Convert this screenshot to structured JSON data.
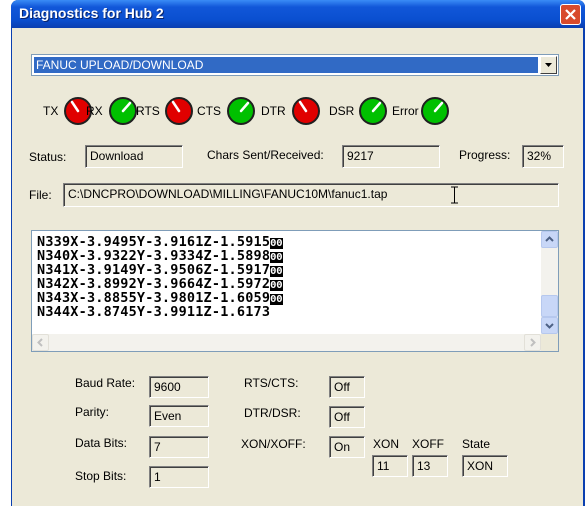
{
  "window": {
    "title": "Diagnostics for Hub 2"
  },
  "mode": {
    "selected": "FANUC UPLOAD/DOWNLOAD"
  },
  "indicators": [
    {
      "label": "TX",
      "state": "red"
    },
    {
      "label": "RX",
      "state": "green"
    },
    {
      "label": "RTS",
      "state": "red"
    },
    {
      "label": "CTS",
      "state": "green"
    },
    {
      "label": "DTR",
      "state": "red"
    },
    {
      "label": "DSR",
      "state": "green"
    },
    {
      "label": "Error",
      "state": "green"
    }
  ],
  "colors": {
    "red": "#e00000",
    "green": "#00c000"
  },
  "status": {
    "label": "Status:",
    "value": "Download"
  },
  "chars": {
    "label": "Chars Sent/Received:",
    "value": "9217"
  },
  "progress": {
    "label": "Progress:",
    "value": "32%"
  },
  "file": {
    "label": "File:",
    "value": "C:\\DNCPRO\\DOWNLOAD\\MILLING\\FANUC10M\\fanuc1.tap"
  },
  "log": [
    {
      "text": "N339X-3.9495Y-3.9161Z-1.5915",
      "cr": "ΘΘ"
    },
    {
      "text": "N340X-3.9322Y-3.9334Z-1.5898",
      "cr": "ΘΘ"
    },
    {
      "text": "N341X-3.9149Y-3.9506Z-1.5917",
      "cr": "ΘΘ"
    },
    {
      "text": "N342X-3.8992Y-3.9664Z-1.5972",
      "cr": "ΘΘ"
    },
    {
      "text": "N343X-3.8855Y-3.9801Z-1.6059",
      "cr": "ΘΘ"
    },
    {
      "text": "N344X-3.8745Y-3.9911Z-1.6173",
      "cr": ""
    }
  ],
  "settings": {
    "baud": {
      "label": "Baud Rate:",
      "value": "9600"
    },
    "parity": {
      "label": "Parity:",
      "value": "Even"
    },
    "databits": {
      "label": "Data Bits:",
      "value": "7"
    },
    "stopbits": {
      "label": "Stop Bits:",
      "value": "1"
    },
    "rtscts": {
      "label": "RTS/CTS:",
      "value": "Off"
    },
    "dtrdsr": {
      "label": "DTR/DSR:",
      "value": "Off"
    },
    "xonxoff": {
      "label": "XON/XOFF:",
      "value": "On"
    },
    "xon": {
      "label": "XON",
      "value": "11"
    },
    "xoff": {
      "label": "XOFF",
      "value": "13"
    },
    "state": {
      "label": "State",
      "value": "XON"
    }
  }
}
